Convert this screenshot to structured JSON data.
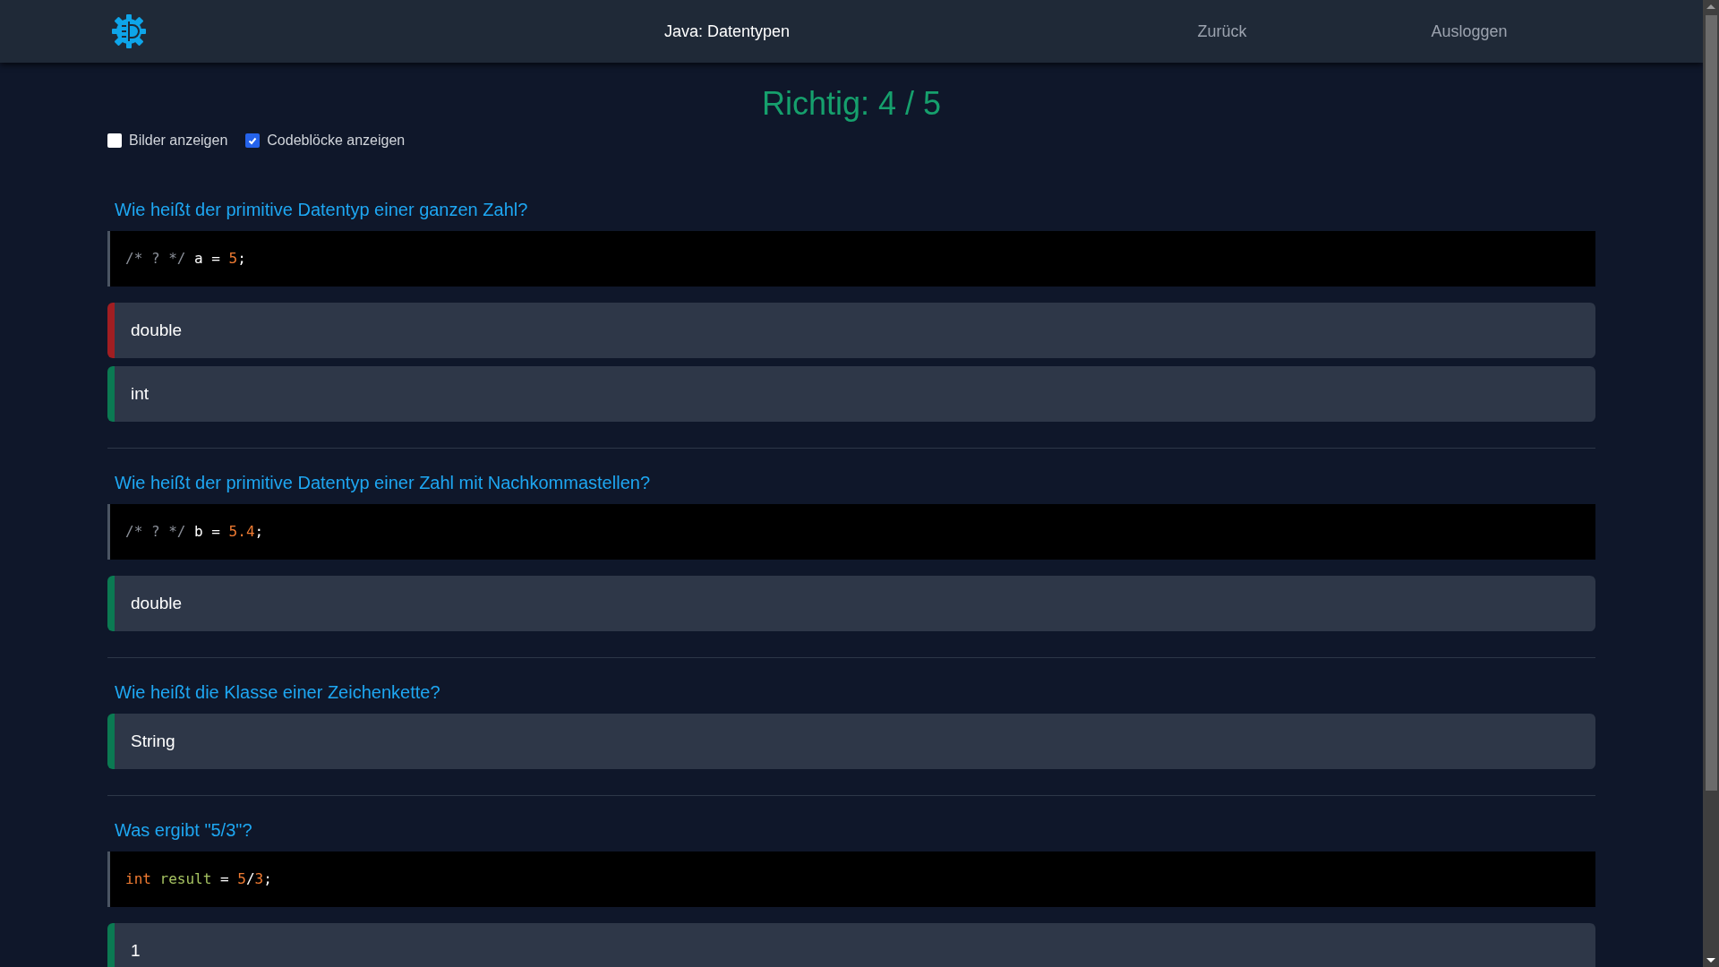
{
  "header": {
    "title": "Java: Datentypen",
    "nav": [
      "Zurück",
      "Ausloggen"
    ]
  },
  "score": "Richtig: 4 / 5",
  "options": [
    {
      "label": "Bilder anzeigen",
      "checked": false
    },
    {
      "label": "Codeblöcke anzeigen",
      "checked": true
    }
  ],
  "questions": [
    {
      "title": "Wie heißt der primitive Datentyp einer ganzen Zahl?",
      "code": [
        {
          "kind": "comment",
          "text": "/* ? */"
        },
        {
          "kind": "plain",
          "text": " a = "
        },
        {
          "kind": "number",
          "text": "5"
        },
        {
          "kind": "plain",
          "text": ";"
        }
      ],
      "answers": [
        {
          "text": "double",
          "correct": false
        },
        {
          "text": "int",
          "correct": true
        }
      ]
    },
    {
      "title": "Wie heißt der primitive Datentyp einer Zahl mit Nachkommastellen?",
      "code": [
        {
          "kind": "comment",
          "text": "/* ? */"
        },
        {
          "kind": "plain",
          "text": " b = "
        },
        {
          "kind": "number",
          "text": "5.4"
        },
        {
          "kind": "plain",
          "text": ";"
        }
      ],
      "answers": [
        {
          "text": "double",
          "correct": true
        }
      ]
    },
    {
      "title": "Wie heißt die Klasse einer Zeichenkette?",
      "answers": [
        {
          "text": "String",
          "correct": true
        }
      ]
    },
    {
      "title": "Was ergibt \"5/3\"?",
      "code": [
        {
          "kind": "keyword",
          "text": "int"
        },
        {
          "kind": "identifier",
          "text": " result"
        },
        {
          "kind": "plain",
          "text": " = "
        },
        {
          "kind": "number",
          "text": "5"
        },
        {
          "kind": "plain",
          "text": "/"
        },
        {
          "kind": "number",
          "text": "3"
        },
        {
          "kind": "plain",
          "text": ";"
        }
      ],
      "answers": [
        {
          "text": "1",
          "correct": true
        }
      ]
    }
  ]
}
